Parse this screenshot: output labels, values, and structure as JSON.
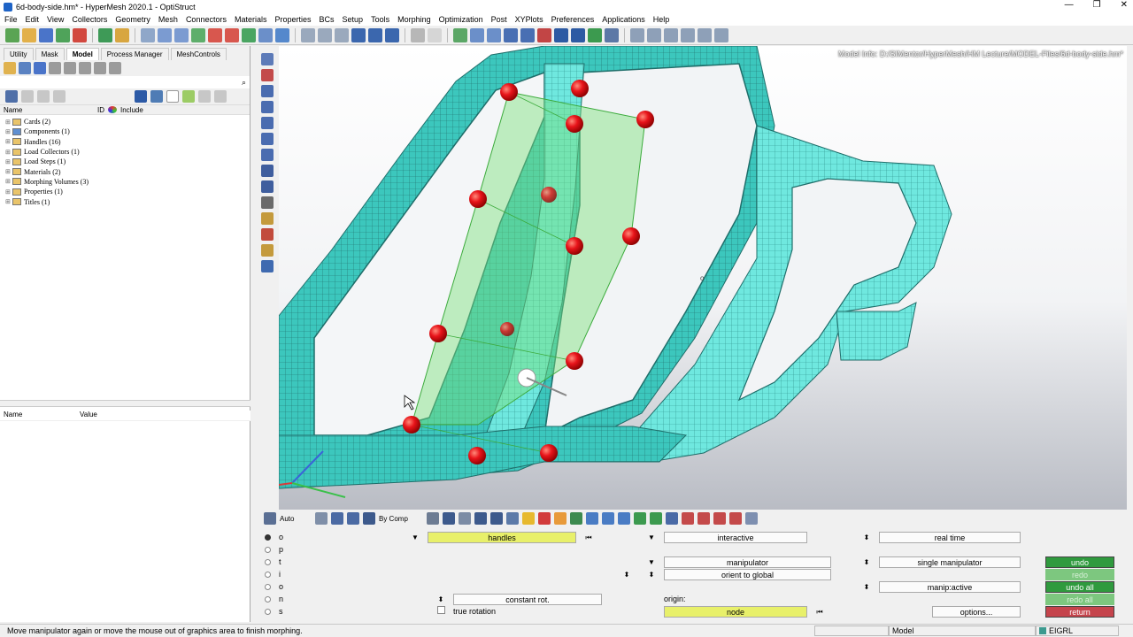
{
  "window": {
    "title": "6d-body-side.hm* - HyperMesh 2020.1 - OptiStruct",
    "controls": [
      "—",
      "❐",
      "✕"
    ]
  },
  "menu": [
    "File",
    "Edit",
    "View",
    "Collectors",
    "Geometry",
    "Mesh",
    "Connectors",
    "Materials",
    "Properties",
    "BCs",
    "Setup",
    "Tools",
    "Morphing",
    "Optimization",
    "Post",
    "XYPlots",
    "Preferences",
    "Applications",
    "Help"
  ],
  "browser": {
    "tabs": [
      "Utility",
      "Mask",
      "Model",
      "Process Manager",
      "MeshControls"
    ],
    "active_tab": "Model",
    "columns": {
      "name": "Name",
      "id": "ID",
      "include": "Include"
    },
    "tree": [
      {
        "label": "Cards (2)"
      },
      {
        "label": "Components (1)"
      },
      {
        "label": "Handles (16)"
      },
      {
        "label": "Load Collectors (1)"
      },
      {
        "label": "Load Steps (1)"
      },
      {
        "label": "Materials (2)"
      },
      {
        "label": "Morphing Volumes (3)"
      },
      {
        "label": "Properties (1)"
      },
      {
        "label": "Titles (1)"
      }
    ],
    "props_columns": {
      "name": "Name",
      "value": "Value"
    }
  },
  "graphics": {
    "model_info": "Model Info: D:/SIMentor/HyperMesh/HM Lecture/MODEL-Files/6d-body-side.hm*"
  },
  "vis_toolbar": {
    "auto_label": "Auto",
    "bycomp_label": "By Comp"
  },
  "morph_panel": {
    "options": "options...",
    "selected": "move handles",
    "handles_label": "handles",
    "constant_rot": "constant rot.",
    "true_rotation": "true rotation",
    "interactive": "interactive",
    "manipulator": "manipulator",
    "orient_to_global": "orient to global",
    "origin_label": "origin:",
    "node_label": "node",
    "real_time": "real time",
    "single_manipulator": "single manipulator",
    "manip_active": "manip:active",
    "undo": "undo",
    "redo": "redo",
    "undo_all": "undo all",
    "redo_all": "redo all",
    "return": "return",
    "colors": {
      "green": "#2f9a3e",
      "light_green": "#7dc77f",
      "return_red": "#c5444c"
    }
  },
  "status": {
    "message": "Move manipulator again or move the mouse out of graphics area to finish morphing.",
    "model_field": "Model",
    "solver_field": "EIGRL"
  }
}
